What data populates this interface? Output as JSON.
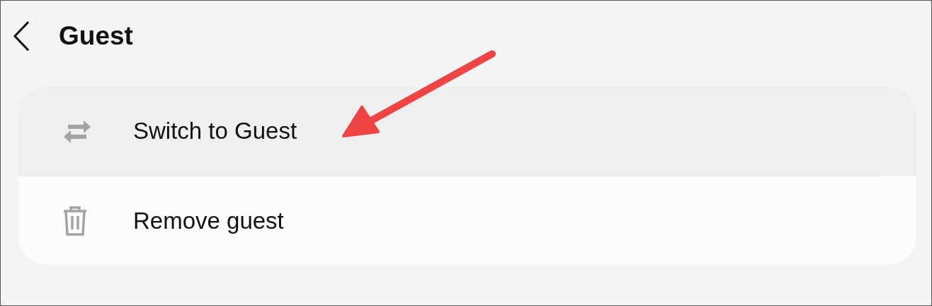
{
  "header": {
    "title": "Guest"
  },
  "items": [
    {
      "kind": "switch",
      "label": "Switch to Guest",
      "selected": true
    },
    {
      "kind": "remove",
      "label": "Remove guest",
      "selected": false
    }
  ]
}
